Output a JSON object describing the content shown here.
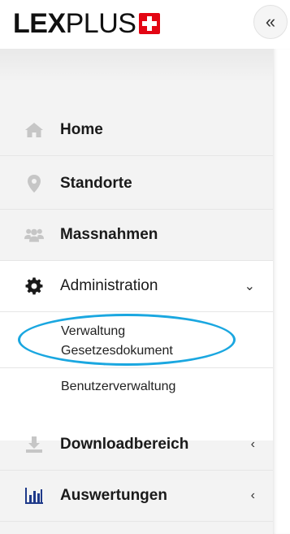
{
  "header": {
    "logo_bold": "LEX",
    "logo_light": "PLUS",
    "collapse_icon": "«"
  },
  "sidebar": {
    "items": [
      {
        "label": "Home",
        "icon": "home-icon"
      },
      {
        "label": "Standorte",
        "icon": "map-marker-icon"
      },
      {
        "label": "Massnahmen",
        "icon": "users-icon"
      },
      {
        "label": "Administration",
        "icon": "gear-icon",
        "chevron": "⌄",
        "expanded": true
      },
      {
        "label": "Downloadbereich",
        "icon": "download-icon",
        "chevron": "‹"
      },
      {
        "label": "Auswertungen",
        "icon": "bar-chart-icon",
        "chevron": "‹"
      }
    ],
    "admin_submenu": [
      {
        "label": "Verwaltung Gesetzesdokument",
        "line1": "Verwaltung",
        "line2": "Gesetzesdokument"
      },
      {
        "label": "Benutzerverwaltung"
      }
    ]
  },
  "colors": {
    "brand_red": "#e30613",
    "highlight": "#1aa7e0",
    "sidebar_bg": "#f3f3f3",
    "icon_muted": "#c6c6c6",
    "icon_dark": "#1a1a1a",
    "chart_blue": "#1f3a8a"
  }
}
